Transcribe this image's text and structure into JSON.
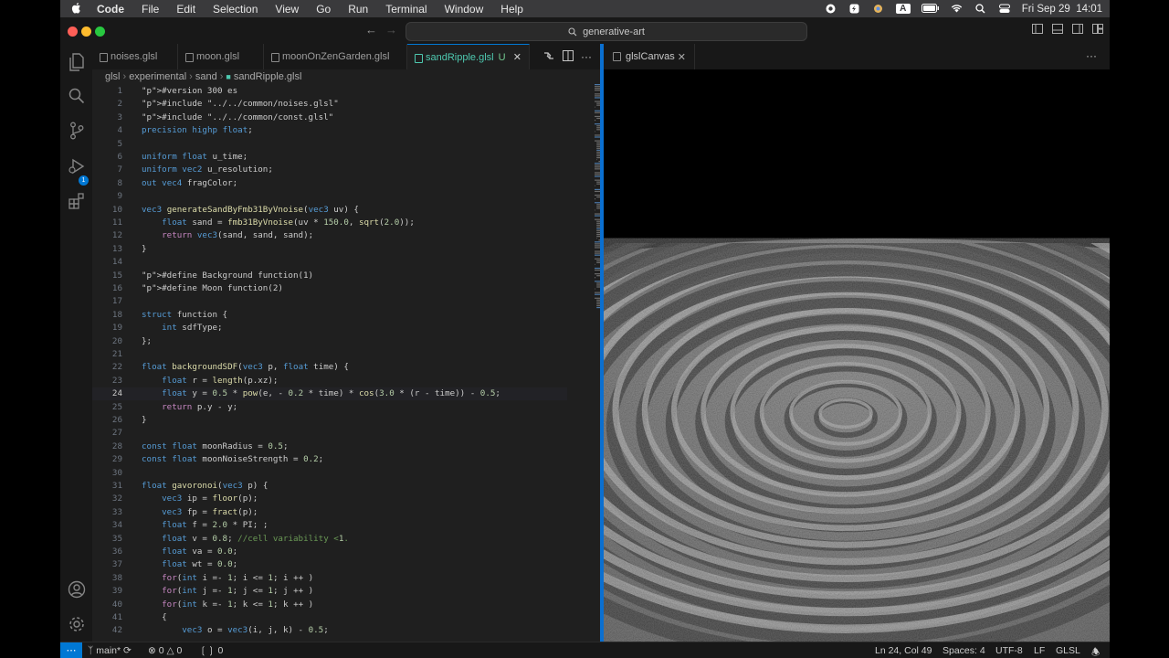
{
  "menubar": {
    "app_name": "Code",
    "items": [
      "File",
      "Edit",
      "Selection",
      "View",
      "Go",
      "Run",
      "Terminal",
      "Window",
      "Help"
    ],
    "clock": "Fri Sep 29  14:01",
    "input_source": "A"
  },
  "titlebar": {
    "search_text": "generative-art"
  },
  "tabs": [
    {
      "label": "noises.glsl"
    },
    {
      "label": "moon.glsl"
    },
    {
      "label": "moonOnZenGarden.glsl"
    },
    {
      "label": "sandRipple.glsl",
      "modified_marker": "U"
    }
  ],
  "breadcrumb": [
    "glsl",
    "experimental",
    "sand",
    "sandRipple.glsl"
  ],
  "source_control_badge": "1",
  "panel": {
    "tab_label": "glslCanvas"
  },
  "code": {
    "current_line": 24,
    "lines": [
      {
        "num": "1",
        "text": "#version 300 es"
      },
      {
        "num": "2",
        "text": "#include \"../../common/noises.glsl\""
      },
      {
        "num": "3",
        "text": "#include \"../../common/const.glsl\""
      },
      {
        "num": "4",
        "text": "precision highp float;"
      },
      {
        "num": "5",
        "text": ""
      },
      {
        "num": "6",
        "text": "uniform float u_time;"
      },
      {
        "num": "7",
        "text": "uniform vec2 u_resolution;"
      },
      {
        "num": "8",
        "text": "out vec4 fragColor;"
      },
      {
        "num": "9",
        "text": ""
      },
      {
        "num": "10",
        "text": "vec3 generateSandByFmb31ByVnoise(vec3 uv) {"
      },
      {
        "num": "11",
        "text": "    float sand = fmb31ByVnoise(uv * 150.0, sqrt(2.0));"
      },
      {
        "num": "12",
        "text": "    return vec3(sand, sand, sand);"
      },
      {
        "num": "13",
        "text": "}"
      },
      {
        "num": "14",
        "text": ""
      },
      {
        "num": "15",
        "text": "#define Background function(1)"
      },
      {
        "num": "16",
        "text": "#define Moon function(2)"
      },
      {
        "num": "17",
        "text": ""
      },
      {
        "num": "18",
        "text": "struct function {"
      },
      {
        "num": "19",
        "text": "    int sdfType;"
      },
      {
        "num": "20",
        "text": "};"
      },
      {
        "num": "21",
        "text": ""
      },
      {
        "num": "22",
        "text": "float backgroundSDF(vec3 p, float time) {"
      },
      {
        "num": "23",
        "text": "    float r = length(p.xz);"
      },
      {
        "num": "24",
        "text": "    float y = 0.5 * pow(e, - 0.2 * time) * cos(3.0 * (r - time)) - 0.5;"
      },
      {
        "num": "25",
        "text": "    return p.y - y;"
      },
      {
        "num": "26",
        "text": "}"
      },
      {
        "num": "27",
        "text": ""
      },
      {
        "num": "28",
        "text": "const float moonRadius = 0.5;"
      },
      {
        "num": "29",
        "text": "const float moonNoiseStrength = 0.2;"
      },
      {
        "num": "30",
        "text": ""
      },
      {
        "num": "31",
        "text": "float gavoronoi(vec3 p) {"
      },
      {
        "num": "32",
        "text": "    vec3 ip = floor(p);"
      },
      {
        "num": "33",
        "text": "    vec3 fp = fract(p);"
      },
      {
        "num": "34",
        "text": "    float f = 2.0 * PI; ;"
      },
      {
        "num": "35",
        "text": "    float v = 0.8; //cell variability <1."
      },
      {
        "num": "36",
        "text": "    float va = 0.0;"
      },
      {
        "num": "37",
        "text": "    float wt = 0.0;"
      },
      {
        "num": "38",
        "text": "    for(int i =- 1; i <= 1; i ++ )"
      },
      {
        "num": "39",
        "text": "    for(int j =- 1; j <= 1; j ++ )"
      },
      {
        "num": "40",
        "text": "    for(int k =- 1; k <= 1; k ++ )"
      },
      {
        "num": "41",
        "text": "    {"
      },
      {
        "num": "42",
        "text": "        vec3 o = vec3(i, j, k) - 0.5;"
      }
    ]
  },
  "statusbar": {
    "branch": "main*",
    "errors": "0",
    "warnings": "0",
    "ports": "0",
    "cursor": "Ln 24, Col 49",
    "spaces": "Spaces: 4",
    "encoding": "UTF-8",
    "eol": "LF",
    "language": "GLSL"
  },
  "colors": {
    "accent": "#0078d4",
    "editor_bg": "#1f1f1f",
    "keyword": "#569cd6",
    "type": "#4ec9b0",
    "function": "#dcdcaa",
    "number": "#b5cea8",
    "string": "#ce9178",
    "comment": "#6a9955"
  },
  "icons": [
    "apple-icon",
    "files-icon",
    "search-icon",
    "source-control-icon",
    "run-debug-icon",
    "extensions-icon",
    "account-icon",
    "manage-gear-icon",
    "split-editor-icon",
    "more-actions-icon",
    "bell-icon"
  ]
}
